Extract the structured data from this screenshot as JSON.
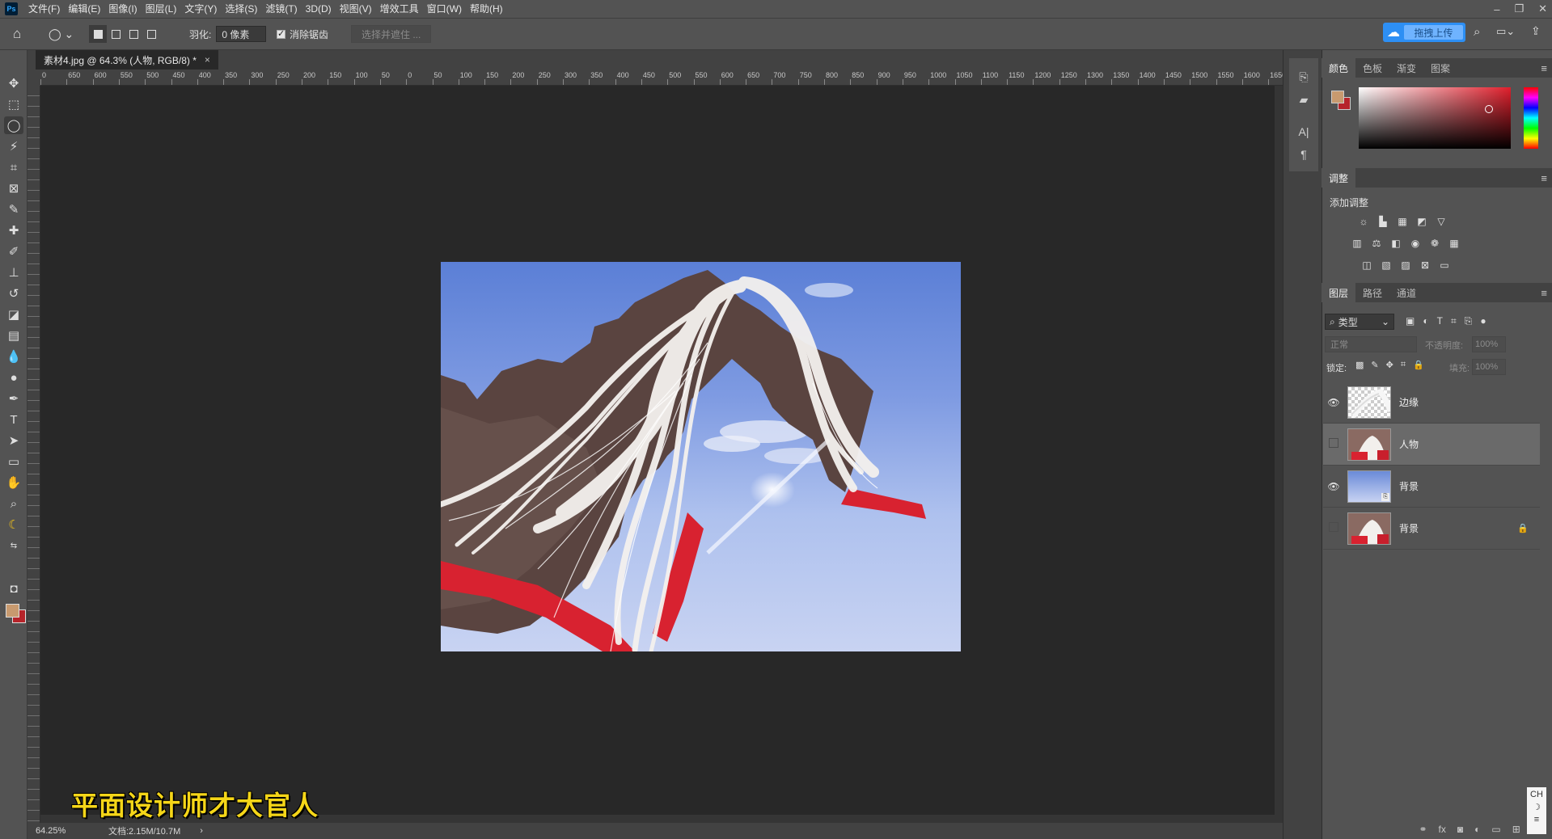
{
  "menu": [
    "文件(F)",
    "编辑(E)",
    "图像(I)",
    "图层(L)",
    "文字(Y)",
    "选择(S)",
    "滤镜(T)",
    "3D(D)",
    "视图(V)",
    "增效工具",
    "窗口(W)",
    "帮助(H)"
  ],
  "options": {
    "feather_label": "羽化:",
    "feather_value": "0 像素",
    "antialias_label": "消除锯齿",
    "select_mask": "选择并遮住 ...",
    "upload": "拖拽上传"
  },
  "document": {
    "tab_title": "素材4.jpg @ 64.3% (人物, RGB/8) *",
    "close": "×"
  },
  "ruler_labels": [
    "0",
    "650",
    "600",
    "550",
    "500",
    "450",
    "400",
    "350",
    "300",
    "250",
    "200",
    "150",
    "100",
    "50",
    "0",
    "50",
    "100",
    "150",
    "200",
    "250",
    "300",
    "350",
    "400",
    "450",
    "500",
    "550",
    "600",
    "650",
    "700",
    "750",
    "800",
    "850",
    "900",
    "950",
    "1000",
    "1050",
    "1100",
    "1150",
    "1200",
    "1250",
    "1300",
    "1350",
    "1400",
    "1450",
    "1500",
    "1550",
    "1600",
    "1650"
  ],
  "status": {
    "zoom": "64.25%",
    "doc_info": "文档:2.15M/10.7M",
    "arrow": "›"
  },
  "watermark": "平面设计师才大官人",
  "color_panel": {
    "tabs": [
      "颜色",
      "色板",
      "渐变",
      "图案"
    ],
    "fg_color": "#c89a6f",
    "bg_color": "#b6242a"
  },
  "adjust_panel": {
    "tab": "调整",
    "add_label": "添加调整"
  },
  "layers_panel": {
    "tabs": [
      "图层",
      "路径",
      "通道"
    ],
    "filter": "类型",
    "blend_mode": "正常",
    "opacity_label": "不透明度:",
    "opacity_value": "100%",
    "lock_label": "锁定:",
    "fill_label": "填充:",
    "fill_value": "100%",
    "layers": [
      {
        "name": "边缘",
        "visible": true
      },
      {
        "name": "人物",
        "visible": false
      },
      {
        "name": "背景",
        "visible": true
      },
      {
        "name": "背景",
        "visible": false
      }
    ]
  },
  "ime": {
    "lang": "CH"
  }
}
